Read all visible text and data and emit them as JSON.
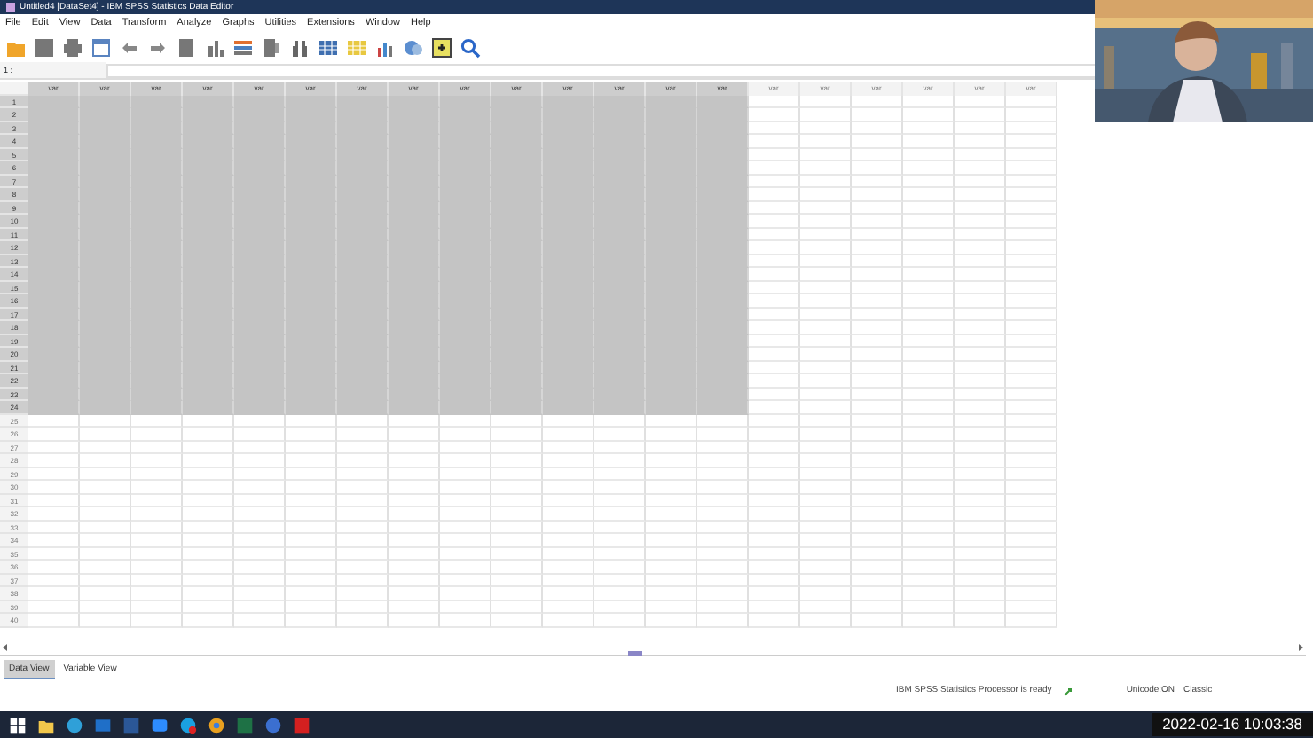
{
  "window": {
    "title": "Untitled4 [DataSet4] - IBM SPSS Statistics Data Editor"
  },
  "menu": [
    "File",
    "Edit",
    "View",
    "Data",
    "Transform",
    "Analyze",
    "Graphs",
    "Utilities",
    "Extensions",
    "Window",
    "Help"
  ],
  "cell_editor": {
    "reference": "1 :"
  },
  "columns": [
    {
      "label": "var",
      "selected": true
    },
    {
      "label": "var",
      "selected": true
    },
    {
      "label": "var",
      "selected": true
    },
    {
      "label": "var",
      "selected": true
    },
    {
      "label": "var",
      "selected": true
    },
    {
      "label": "var",
      "selected": true
    },
    {
      "label": "var",
      "selected": true
    },
    {
      "label": "var",
      "selected": true
    },
    {
      "label": "var",
      "selected": true
    },
    {
      "label": "var",
      "selected": true
    },
    {
      "label": "var",
      "selected": true
    },
    {
      "label": "var",
      "selected": true
    },
    {
      "label": "var",
      "selected": true
    },
    {
      "label": "var",
      "selected": true
    },
    {
      "label": "var",
      "selected": false
    },
    {
      "label": "var",
      "selected": false
    },
    {
      "label": "var",
      "selected": false
    },
    {
      "label": "var",
      "selected": false
    },
    {
      "label": "var",
      "selected": false
    },
    {
      "label": "var",
      "selected": false
    }
  ],
  "rows": [
    {
      "label": "1",
      "selected": true
    },
    {
      "label": "2",
      "selected": true
    },
    {
      "label": "3",
      "selected": true
    },
    {
      "label": "4",
      "selected": true
    },
    {
      "label": "5",
      "selected": true
    },
    {
      "label": "6",
      "selected": true
    },
    {
      "label": "7",
      "selected": true
    },
    {
      "label": "8",
      "selected": true
    },
    {
      "label": "9",
      "selected": true
    },
    {
      "label": "10",
      "selected": true
    },
    {
      "label": "11",
      "selected": true
    },
    {
      "label": "12",
      "selected": true
    },
    {
      "label": "13",
      "selected": true
    },
    {
      "label": "14",
      "selected": true
    },
    {
      "label": "15",
      "selected": true
    },
    {
      "label": "16",
      "selected": true
    },
    {
      "label": "17",
      "selected": true
    },
    {
      "label": "18",
      "selected": true
    },
    {
      "label": "19",
      "selected": true
    },
    {
      "label": "20",
      "selected": true
    },
    {
      "label": "21",
      "selected": true
    },
    {
      "label": "22",
      "selected": true
    },
    {
      "label": "23",
      "selected": true
    },
    {
      "label": "24",
      "selected": true
    },
    {
      "label": "25",
      "selected": false
    },
    {
      "label": "26",
      "selected": false
    },
    {
      "label": "27",
      "selected": false
    },
    {
      "label": "28",
      "selected": false
    },
    {
      "label": "29",
      "selected": false
    },
    {
      "label": "30",
      "selected": false
    },
    {
      "label": "31",
      "selected": false
    },
    {
      "label": "32",
      "selected": false
    },
    {
      "label": "33",
      "selected": false
    },
    {
      "label": "34",
      "selected": false
    },
    {
      "label": "35",
      "selected": false
    },
    {
      "label": "36",
      "selected": false
    },
    {
      "label": "37",
      "selected": false
    },
    {
      "label": "38",
      "selected": false
    },
    {
      "label": "39",
      "selected": false
    },
    {
      "label": "40",
      "selected": false
    }
  ],
  "view_tabs": [
    {
      "label": "Data View",
      "selected": true
    },
    {
      "label": "Variable View",
      "selected": false
    }
  ],
  "status_bar": {
    "processor": "IBM SPSS Statistics Processor is ready",
    "unicode": "Unicode:ON",
    "mode": "Classic"
  },
  "timestamp": "2022-02-16 10:03:38"
}
